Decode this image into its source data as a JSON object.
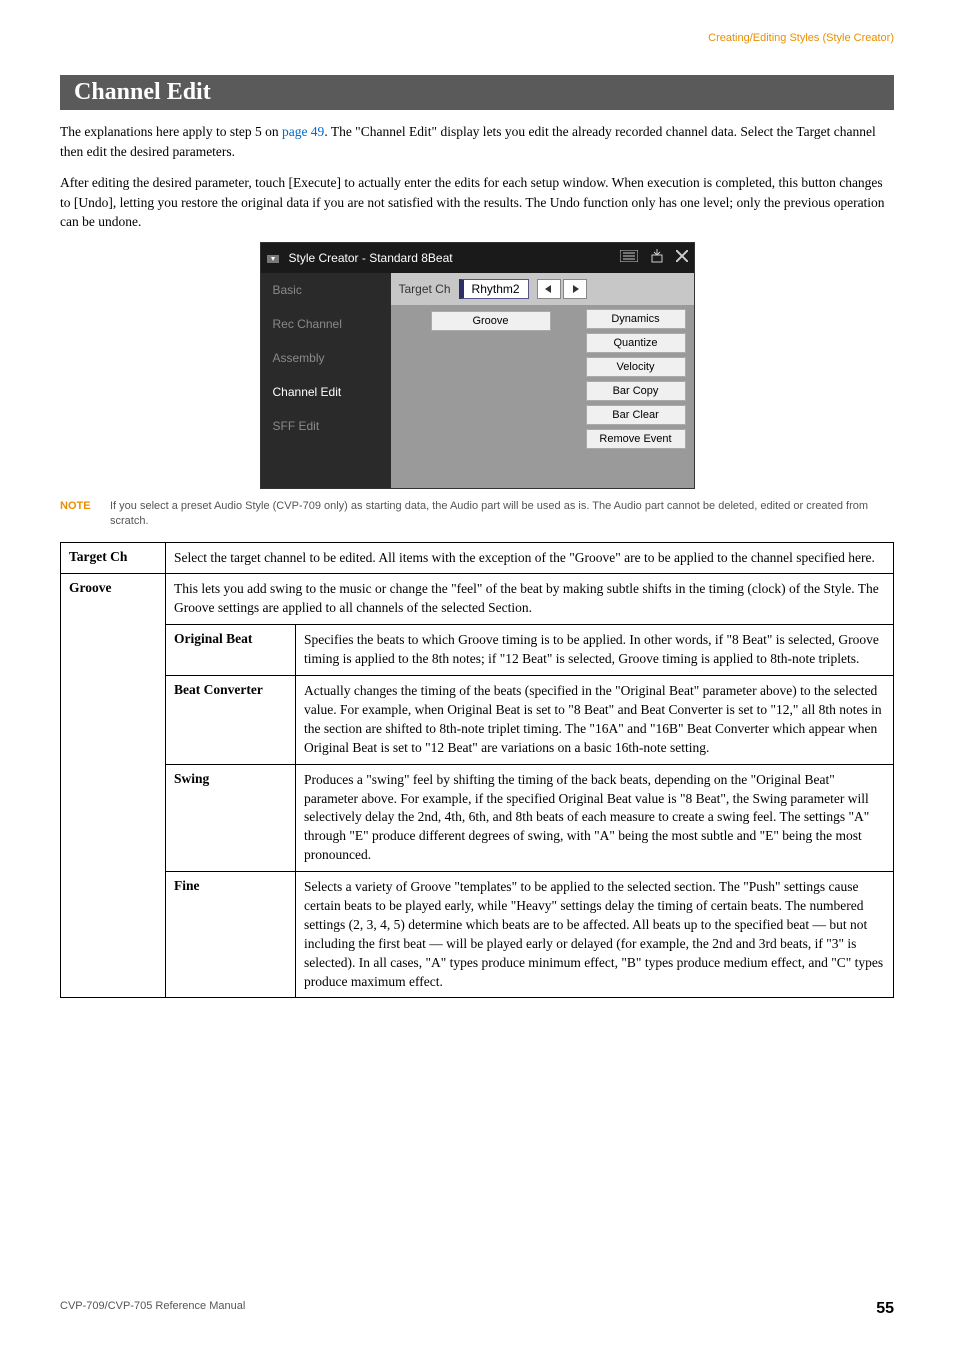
{
  "header_right": "Creating/Editing Styles (Style Creator)",
  "section_title": "Channel Edit",
  "intro_1a": "The explanations here apply to step 5 on ",
  "intro_1_link": "page 49",
  "intro_1b": ". The \"Channel Edit\" display lets you edit the already recorded channel data. Select the Target channel then edit the desired parameters.",
  "intro_2": "After editing the desired parameter, touch [Execute] to actually enter the edits for each setup window. When execution is completed, this button changes to [Undo], letting you restore the original data if you are not satisfied with the results. The Undo function only has one level; only the previous operation can be undone.",
  "screenshot": {
    "title": "Style Creator - Standard 8Beat",
    "sidebar": [
      "Basic",
      "Rec Channel",
      "Assembly",
      "Channel Edit",
      "SFF Edit"
    ],
    "sidebar_active_index": 3,
    "target_label": "Target Ch",
    "target_value": "Rhythm2",
    "center_button": "Groove",
    "right_buttons": [
      "Dynamics",
      "Quantize",
      "Velocity",
      "Bar Copy",
      "Bar Clear",
      "Remove Event"
    ]
  },
  "note_kw": "NOTE",
  "note_text": "If you select a preset Audio Style (CVP-709 only) as starting data, the Audio part will be used as is. The Audio part cannot be deleted, edited or created from scratch.",
  "table": {
    "target_ch_label": "Target Ch",
    "target_ch_desc": "Select the target channel to be edited. All items with the exception of the \"Groove\" are to be applied to the channel specified here.",
    "groove_label": "Groove",
    "groove_desc": "This lets you add swing to the music or change the \"feel\" of the beat by making subtle shifts in the timing (clock) of the Style. The Groove settings are applied to all channels of the selected Section.",
    "rows": [
      {
        "name": "Original Beat",
        "desc": "Specifies the beats to which Groove timing is to be applied. In other words, if \"8 Beat\" is selected, Groove timing is applied to the 8th notes; if \"12 Beat\" is selected, Groove timing is applied to 8th-note triplets."
      },
      {
        "name": "Beat Converter",
        "desc": "Actually changes the timing of the beats (specified in the \"Original Beat\" parameter above) to the selected value. For example, when Original Beat is set to \"8 Beat\" and Beat Converter is set to \"12,\" all 8th notes in the section are shifted to 8th-note triplet timing. The \"16A\" and \"16B\" Beat Converter which appear when Original Beat is set to \"12 Beat\" are variations on a basic 16th-note setting."
      },
      {
        "name": "Swing",
        "desc": "Produces a \"swing\" feel by shifting the timing of the back beats, depending on the \"Original Beat\" parameter above. For example, if the specified Original Beat value is \"8 Beat\", the Swing parameter will selectively delay the 2nd, 4th, 6th, and 8th beats of each measure to create a swing feel. The settings \"A\" through \"E\" produce different degrees of swing, with \"A\" being the most subtle and \"E\" being the most pronounced."
      },
      {
        "name": "Fine",
        "desc": "Selects a variety of Groove \"templates\" to be applied to the selected section. The \"Push\" settings cause certain beats to be played early, while \"Heavy\" settings delay the timing of certain beats. The numbered settings (2, 3, 4, 5) determine which beats are to be affected. All beats up to the specified beat — but not including the first beat — will be played early or delayed (for example, the 2nd and 3rd beats, if \"3\" is selected). In all cases, \"A\" types produce minimum effect, \"B\" types produce medium effect, and \"C\" types produce maximum effect."
      }
    ]
  },
  "footer_left": "CVP-709/CVP-705 Reference Manual",
  "footer_page": "55"
}
